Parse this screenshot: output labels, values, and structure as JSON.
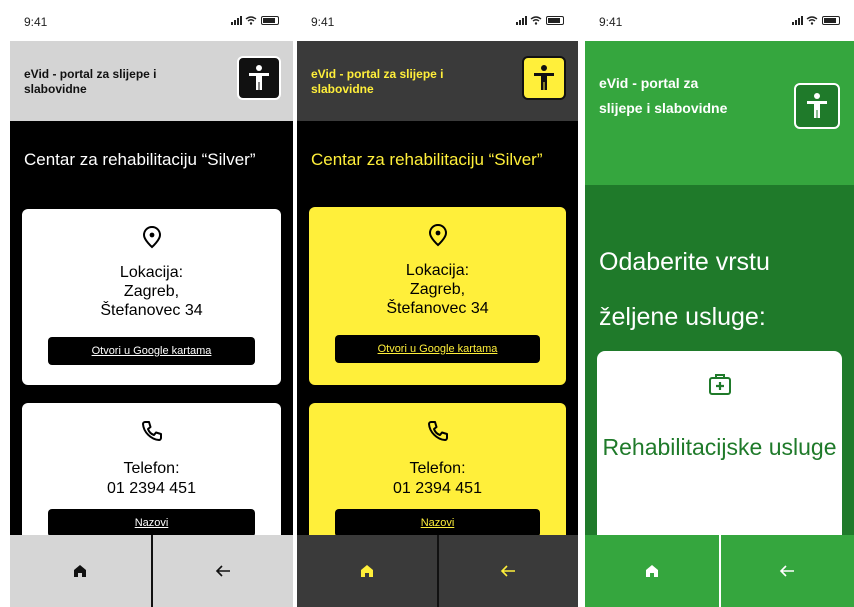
{
  "colors": {
    "theme1_bg": "#000000",
    "theme1_card": "#ffffff",
    "theme2_accent": "#ffef3a",
    "theme2_header": "#3a3a3a",
    "theme3_green": "#35a63e",
    "theme3_dark_green": "#1f7a2a"
  },
  "screens": [
    {
      "status_time": "9:41",
      "app_title": "eVid - portal za slijepe i slabovidne",
      "content_title": "Centar za rehabilitaciju “Silver”",
      "location": {
        "icon": "map-pin-icon",
        "label_line1": "Lokacija:",
        "label_line2": "Zagreb,",
        "label_line3": "Štefanovec 34",
        "button": "Otvori u Google kartama"
      },
      "phone": {
        "icon": "phone-icon",
        "label_line1": "Telefon:",
        "label_line2": "01 2394 451",
        "button": "Nazovi"
      },
      "nav": {
        "home_icon": "home-icon",
        "back_icon": "back-arrow-icon"
      }
    },
    {
      "status_time": "9:41",
      "app_title": "eVid - portal za slijepe i slabovidne",
      "content_title": "Centar za rehabilitaciju “Silver”",
      "location": {
        "icon": "map-pin-icon",
        "label_line1": "Lokacija:",
        "label_line2": "Zagreb,",
        "label_line3": "Štefanovec 34",
        "button": "Otvori u Google kartama"
      },
      "phone": {
        "icon": "phone-icon",
        "label_line1": "Telefon:",
        "label_line2": "01 2394 451",
        "button": "Nazovi"
      },
      "nav": {
        "home_icon": "home-icon",
        "back_icon": "back-arrow-icon"
      }
    },
    {
      "status_time": "9:41",
      "app_title": "eVid - portal za slijepe i slabovidne",
      "content_title": "Odaberite vrstu željene usluge:",
      "service": {
        "icon": "first-aid-kit-icon",
        "label": "Rehabilitacijske usluge"
      },
      "nav": {
        "home_icon": "home-icon",
        "back_icon": "back-arrow-icon"
      }
    }
  ]
}
